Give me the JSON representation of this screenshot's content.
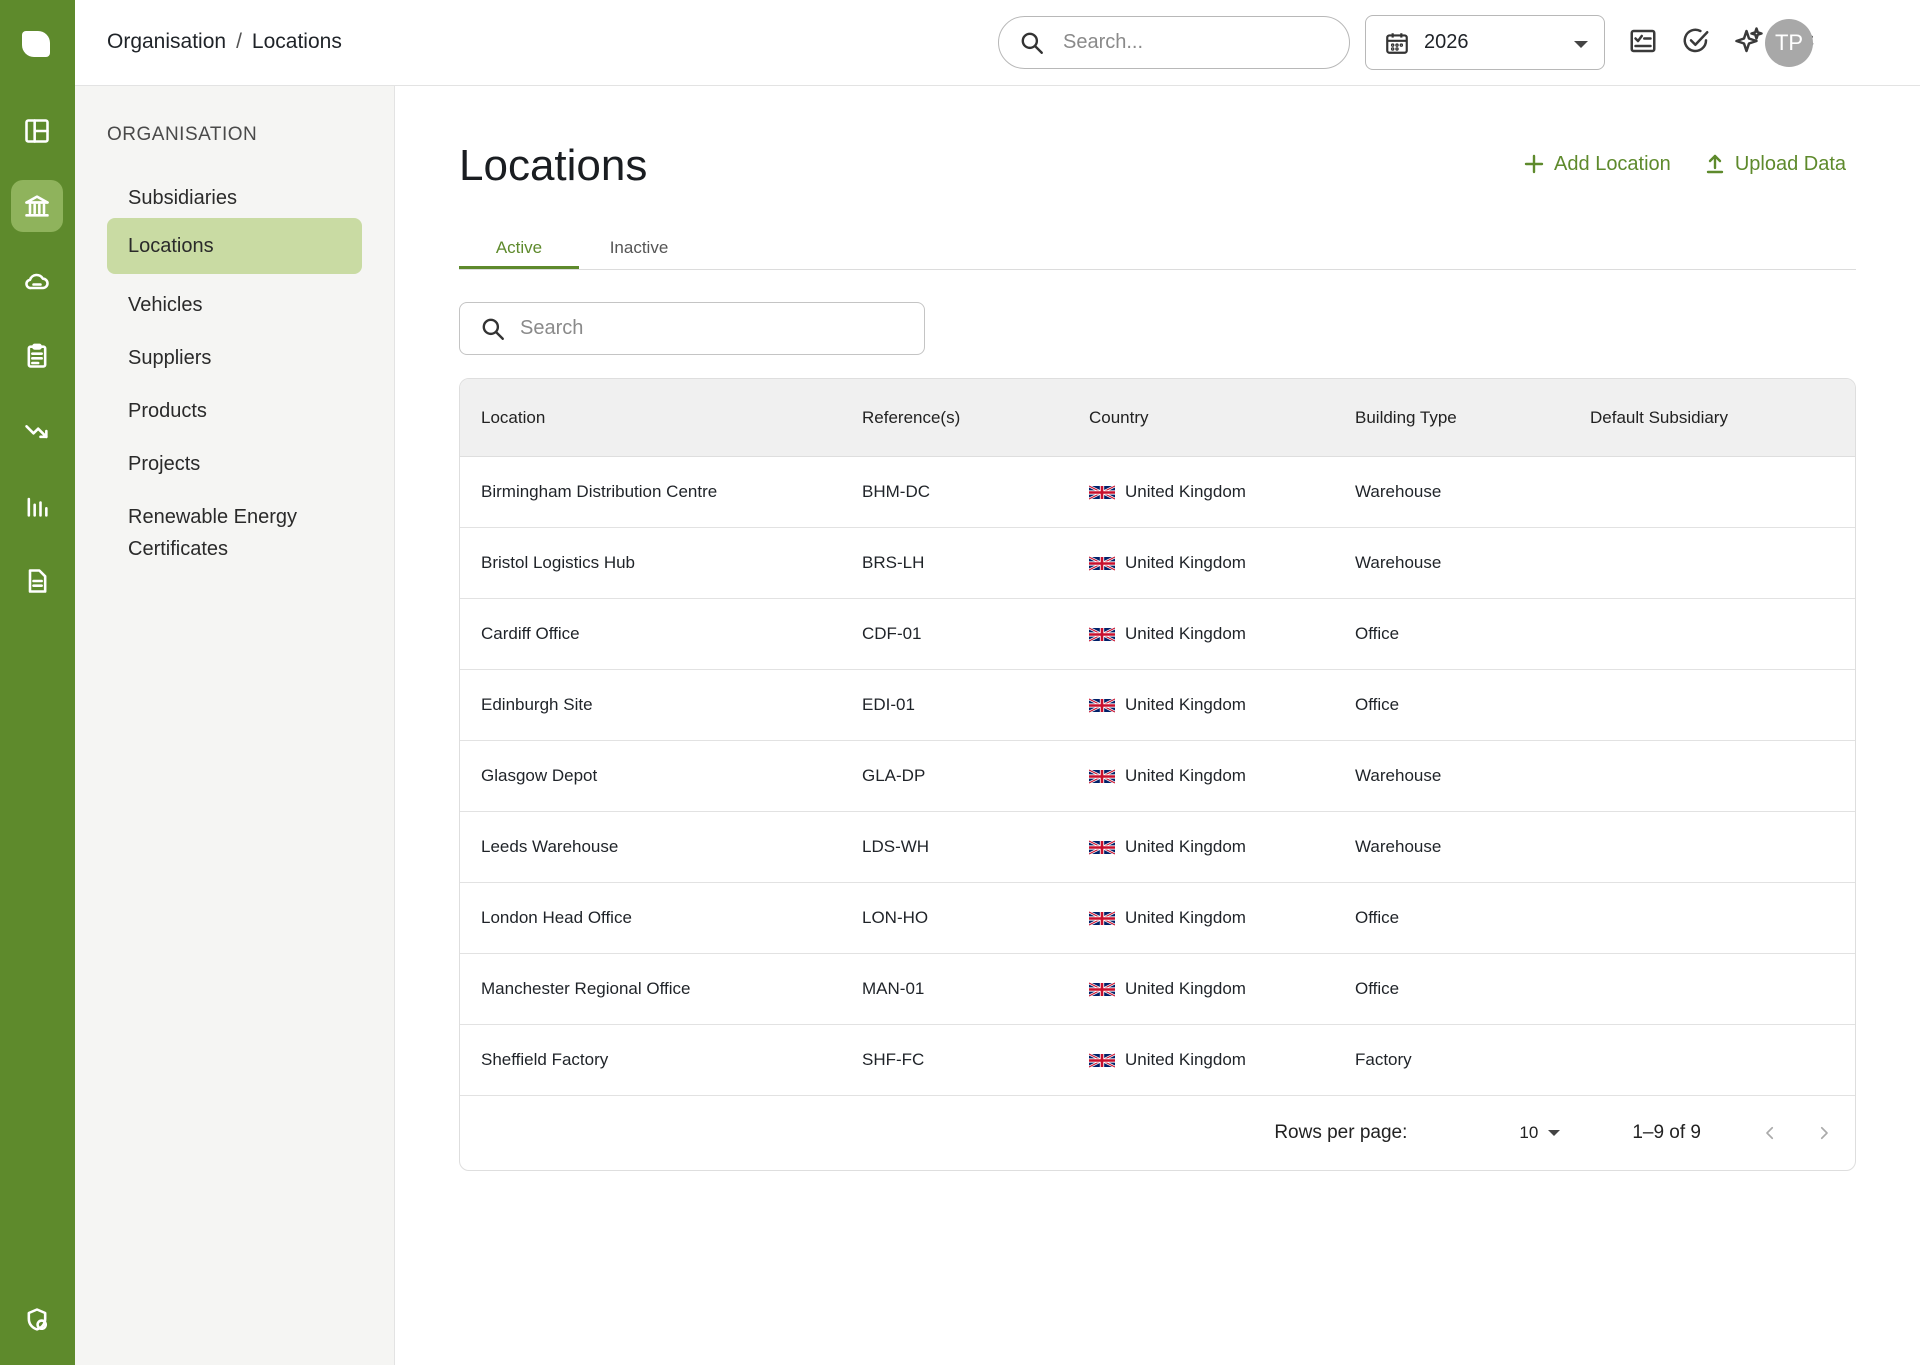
{
  "header": {
    "breadcrumb": [
      "Organisation",
      "/",
      "Locations"
    ],
    "search_placeholder": "Search...",
    "year": "2026",
    "avatar_initials": "TP"
  },
  "rail": {
    "icons": [
      "logo-icon",
      "dashboard-icon",
      "organisation-icon",
      "cloud-icon",
      "clipboard-icon",
      "trend-down-icon",
      "bar-chart-icon",
      "document-icon",
      "shield-user-icon"
    ],
    "accent": "#5e8a2c"
  },
  "sidebar": {
    "heading": "ORGANISATION",
    "items": [
      {
        "label": "Subsidiaries"
      },
      {
        "label": "Locations",
        "active": true
      },
      {
        "label": "Vehicles"
      },
      {
        "label": "Suppliers"
      },
      {
        "label": "Products"
      },
      {
        "label": "Projects"
      },
      {
        "label": "Renewable Energy Certificates"
      }
    ]
  },
  "main": {
    "title": "Locations",
    "add_label": "Add Location",
    "upload_label": "Upload Data",
    "tabs": [
      {
        "label": "Active",
        "active": true
      },
      {
        "label": "Inactive"
      }
    ],
    "search_placeholder": "Search"
  },
  "table": {
    "columns": [
      "Location",
      "Reference(s)",
      "Country",
      "Building Type",
      "Default Subsidiary"
    ],
    "rows": [
      {
        "location": "Birmingham Distribution Centre",
        "ref": "BHM-DC",
        "country": "United Kingdom",
        "building": "Warehouse",
        "subsidiary": ""
      },
      {
        "location": "Bristol Logistics Hub",
        "ref": "BRS-LH",
        "country": "United Kingdom",
        "building": "Warehouse",
        "subsidiary": ""
      },
      {
        "location": "Cardiff Office",
        "ref": "CDF-01",
        "country": "United Kingdom",
        "building": "Office",
        "subsidiary": ""
      },
      {
        "location": "Edinburgh Site",
        "ref": "EDI-01",
        "country": "United Kingdom",
        "building": "Office",
        "subsidiary": ""
      },
      {
        "location": "Glasgow Depot",
        "ref": "GLA-DP",
        "country": "United Kingdom",
        "building": "Warehouse",
        "subsidiary": ""
      },
      {
        "location": "Leeds Warehouse",
        "ref": "LDS-WH",
        "country": "United Kingdom",
        "building": "Warehouse",
        "subsidiary": ""
      },
      {
        "location": "London Head Office",
        "ref": "LON-HO",
        "country": "United Kingdom",
        "building": "Office",
        "subsidiary": ""
      },
      {
        "location": "Manchester Regional Office",
        "ref": "MAN-01",
        "country": "United Kingdom",
        "building": "Office",
        "subsidiary": ""
      },
      {
        "location": "Sheffield Factory",
        "ref": "SHF-FC",
        "country": "United Kingdom",
        "building": "Factory",
        "subsidiary": ""
      }
    ],
    "pagination": {
      "rows_per_page_label": "Rows per page:",
      "rows_per_page": "10",
      "range": "1–9 of 9"
    }
  }
}
